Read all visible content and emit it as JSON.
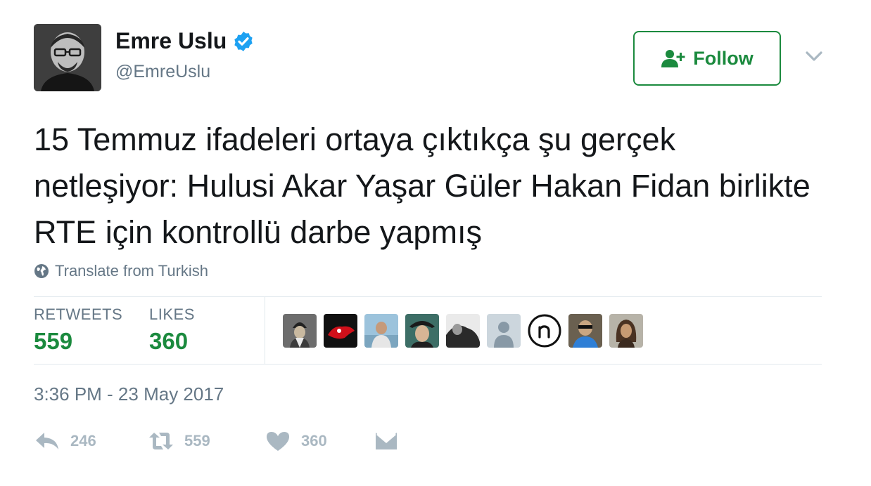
{
  "author": {
    "name": "Emre Uslu",
    "handle": "@EmreUslu",
    "verified": true
  },
  "follow_button": {
    "label": "Follow"
  },
  "tweet": {
    "text": "15 Temmuz ifadeleri ortaya çıktıkça şu gerçek netleşiyor: Hulusi Akar Yaşar Güler Hakan Fidan birlikte RTE için kontrollü darbe yapmış",
    "translate_label": "Translate from Turkish",
    "timestamp": "3:36 PM - 23 May 2017"
  },
  "stats": {
    "retweets_label": "RETWEETS",
    "retweets_value": "559",
    "likes_label": "LIKES",
    "likes_value": "360"
  },
  "actions": {
    "reply_count": "246",
    "retweet_count": "559",
    "like_count": "360"
  },
  "colors": {
    "accent": "#1b8a3e",
    "verified": "#1da1f2",
    "muted": "#657786",
    "icon": "#aab8c2"
  }
}
